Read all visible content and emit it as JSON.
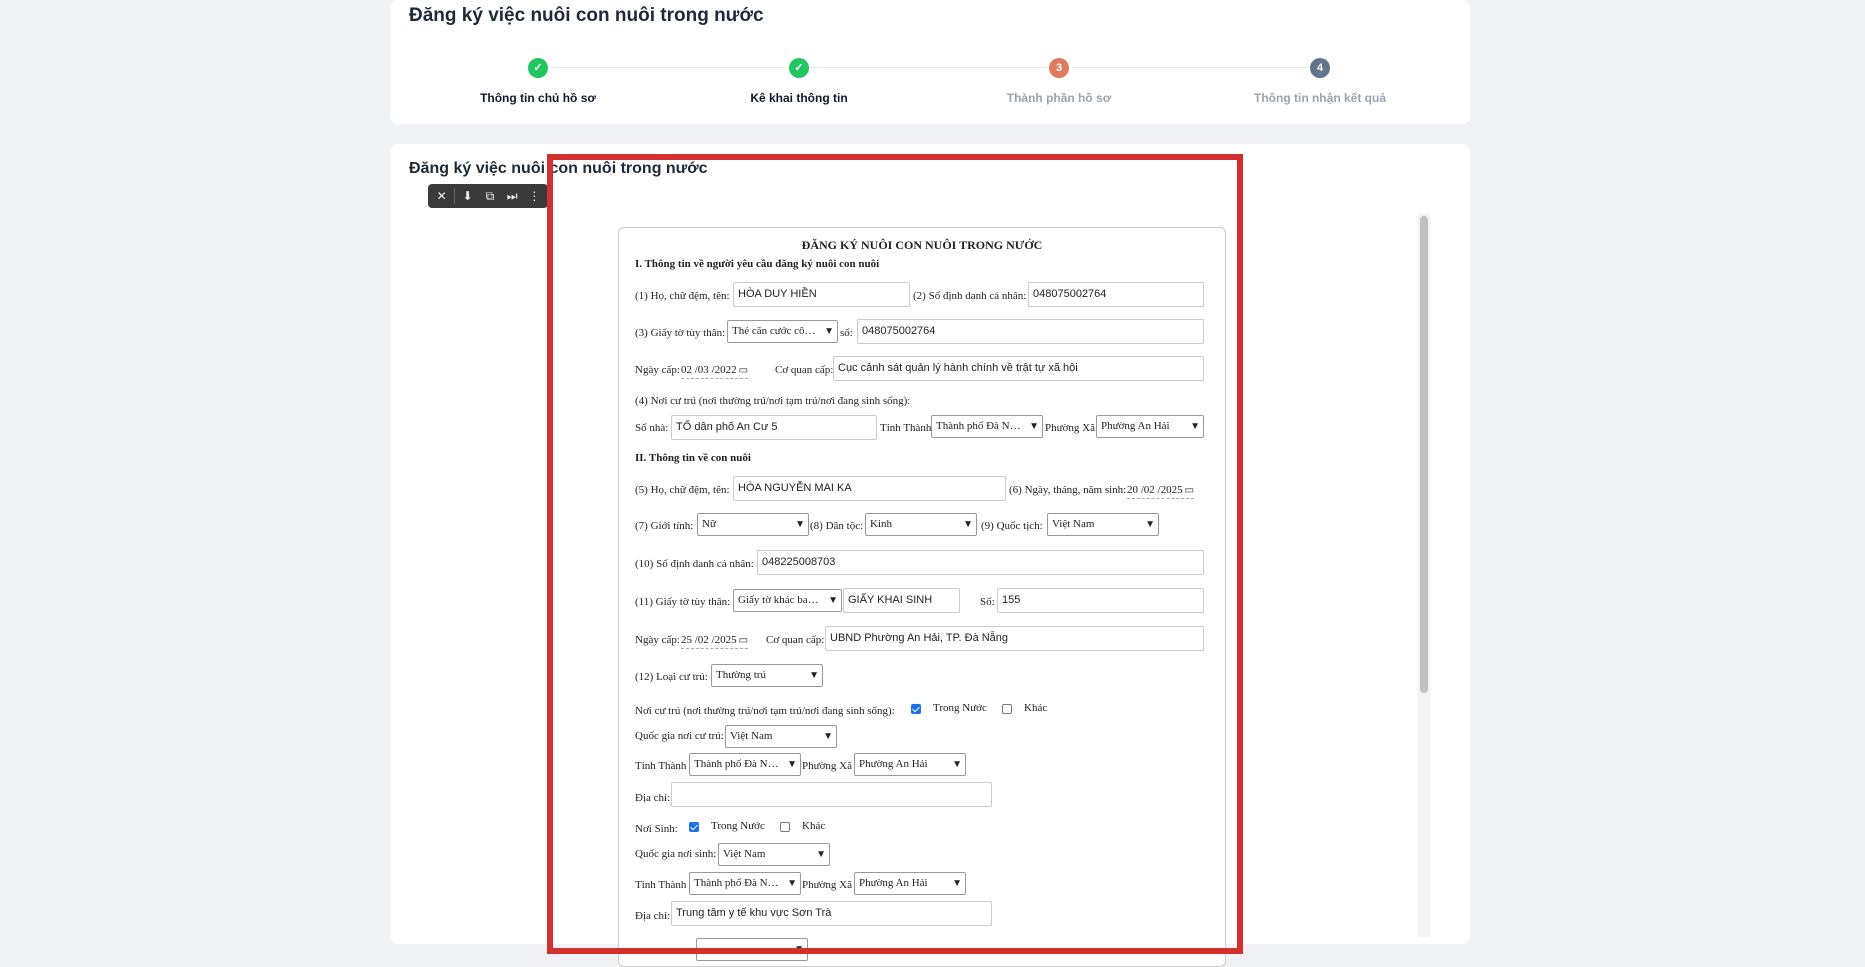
{
  "page": {
    "title": "Đăng ký việc nuôi con nuôi trong nước"
  },
  "stepper": {
    "steps": [
      {
        "label": "Thông tin chủ hồ sơ",
        "state": "done",
        "badge": "✓"
      },
      {
        "label": "Kê khai thông tin",
        "state": "done",
        "badge": "✓"
      },
      {
        "label": "Thành phần hồ sơ",
        "state": "current",
        "badge": "3"
      },
      {
        "label": "Thông tin nhận kết quả",
        "state": "todo",
        "badge": "4"
      }
    ]
  },
  "section": {
    "title": "Đăng ký việc nuôi con nuôi trong nước"
  },
  "toolbar": {
    "icons": [
      "close-icon",
      "download-icon",
      "picture-in-picture-icon",
      "skip-next-icon",
      "more-vertical-icon"
    ]
  },
  "form": {
    "title": "ĐĂNG KÝ NUÔI CON NUÔI TRONG NƯỚC",
    "section1": "I. Thông tin về người yêu cầu đăng ký nuôi con nuôi",
    "requester": {
      "name_label": "(1) Họ, chữ đệm, tên:",
      "name_value": "HÒA DUY HIỀN",
      "id_label": "(2) Số định danh cá nhân:",
      "id_value": "048075002764",
      "doc_label": "(3) Giấy tờ tùy thân:",
      "doc_type": "Thẻ căn cước cô…",
      "doc_no_label": "số:",
      "doc_no_value": "048075002764",
      "issue_date_label": "Ngày cấp:",
      "issue_date": "02 /03 /2022",
      "issuer_label": "Cơ quan cấp:",
      "issuer_value": "Cục cảnh sát quản lý hành chính về trật tự xã hội",
      "residence_label": "(4) Nơi cư trú (nơi thường trú/nơi tạm trú/nơi đang sinh sống):",
      "house_label": "Số nhà:",
      "house_value": "TỔ dân phố An Cư 5",
      "province_label": "Tỉnh Thành",
      "province_value": "Thành phố Đà N…",
      "ward_label": "Phường Xã",
      "ward_value": "Phường An Hải"
    },
    "section2": "II. Thông tin về con nuôi",
    "child": {
      "name_label": "(5) Họ, chữ đệm, tên:",
      "name_value": "HÒA NGUYỄN MAI KA",
      "dob_label": "(6) Ngày, tháng, năm sinh:",
      "dob": "20 /02 /2025",
      "gender_label": "(7) Giới tính:",
      "gender_value": "Nữ",
      "ethnicity_label": "(8) Dân tộc:",
      "ethnicity_value": "Kinh",
      "nationality_label": "(9) Quốc tịch:",
      "nationality_value": "Việt Nam",
      "id_label": "(10) Số định danh cá nhân:",
      "id_value": "048225008703",
      "doc_label": "(11) Giấy tờ tùy thân:",
      "doc_type": "Giấy tờ khác ba…",
      "doc_name": "GIẤY KHAI SINH",
      "doc_no_label": "Số:",
      "doc_no_value": "155",
      "issue_date_label": "Ngày cấp:",
      "issue_date": "25 /02 /2025",
      "issuer_label": "Cơ quan cấp:",
      "issuer_value": "UBND Phường An Hải, TP. Đà Nẵng",
      "residence_type_label": "(12) Loại cư trú:",
      "residence_type_value": "Thường trú",
      "residence_label": "Nơi cư trú (nơi thường trú/nơi tạm trú/nơi đang sinh sống):",
      "domestic_label": "Trong Nước",
      "other_label": "Khác",
      "res_country_label": "Quốc gia nơi cư trú:",
      "res_country_value": "Việt Nam",
      "res_province_label": "Tỉnh Thành",
      "res_province_value": "Thành phố Đà N…",
      "res_ward_label": "Phường Xã",
      "res_ward_value": "Phường An Hải",
      "res_address_label": "Địa chỉ:",
      "res_address_value": "",
      "birthplace_label": "Nơi Sinh:",
      "birth_country_label": "Quốc gia nơi sinh:",
      "birth_country_value": "Việt Nam",
      "birth_province_label": "Tỉnh Thành",
      "birth_province_value": "Thành phố Đà N…",
      "birth_ward_label": "Phường Xã",
      "birth_ward_value": "Phường An Hải",
      "birth_address_label": "Địa chỉ:",
      "birth_address_value": "Trung tâm y tế khu vực Sơn Trà"
    }
  }
}
